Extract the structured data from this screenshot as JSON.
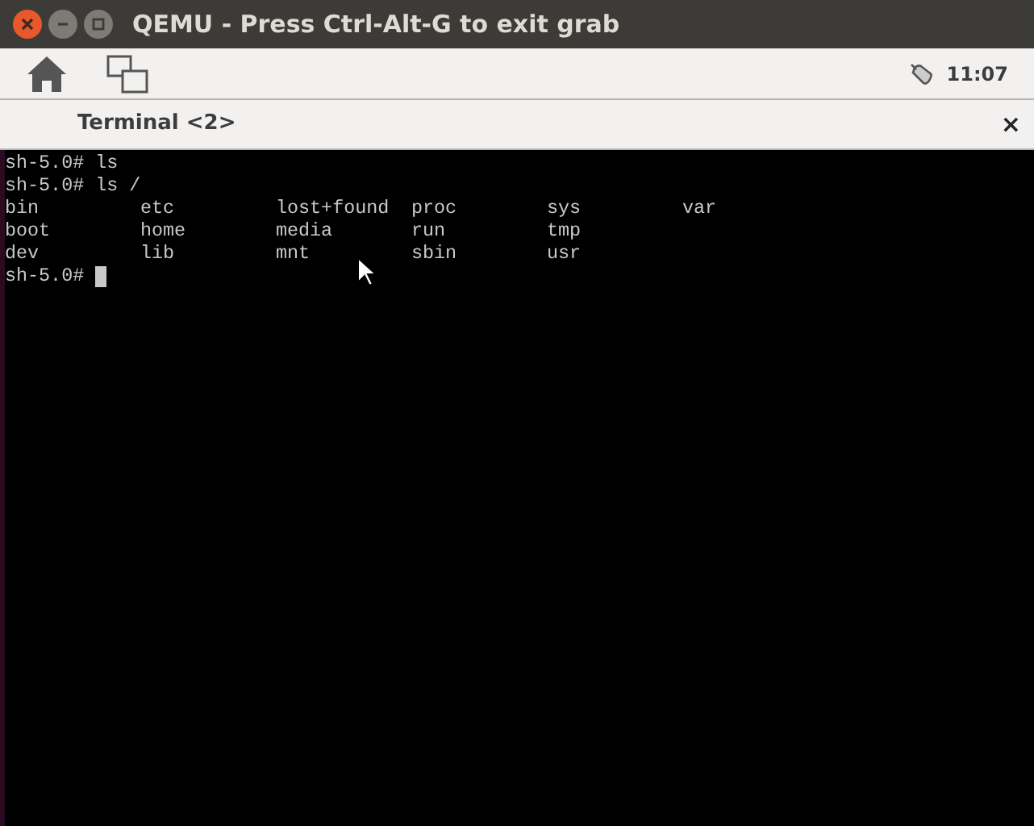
{
  "window": {
    "title": "QEMU - Press Ctrl-Alt-G to exit grab"
  },
  "toolbar": {
    "clock": "11:07"
  },
  "tab": {
    "title": "Terminal <2>",
    "close": "×"
  },
  "terminal": {
    "lines": [
      {
        "kind": "text",
        "text": "sh-5.0# ls"
      },
      {
        "kind": "text",
        "text": "sh-5.0# ls /"
      },
      {
        "kind": "columns",
        "cells": [
          "bin",
          "etc",
          "lost+found",
          "proc",
          "sys",
          "var"
        ]
      },
      {
        "kind": "columns",
        "cells": [
          "boot",
          "home",
          "media",
          "run",
          "tmp"
        ]
      },
      {
        "kind": "columns",
        "cells": [
          "dev",
          "lib",
          "mnt",
          "sbin",
          "usr"
        ]
      },
      {
        "kind": "prompt",
        "text": "sh-5.0#",
        "cursor": true
      }
    ]
  }
}
